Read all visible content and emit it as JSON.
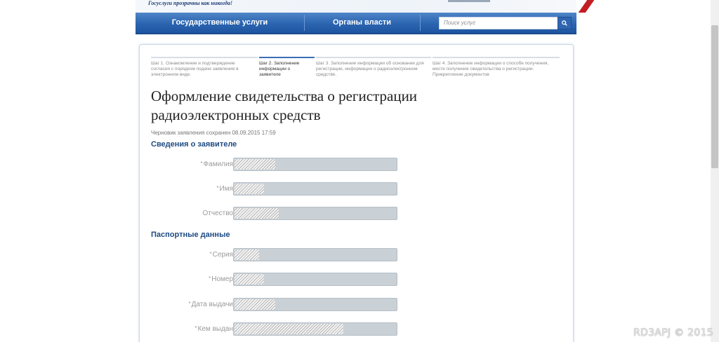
{
  "banner": {
    "slogan": "Госуслуги прозрачны как никогда!"
  },
  "nav": {
    "items": [
      {
        "label": "Государственные услуги"
      },
      {
        "label": "Органы власти"
      }
    ],
    "search": {
      "placeholder": "Поиск услуг"
    },
    "search_icon": "search-icon"
  },
  "steps": [
    {
      "label": "Шаг 1. Ознакомление и подтверждение согласия с порядком подачи заявления в электронном виде."
    },
    {
      "label": "Шаг 2. Заполнение информации о заявителе",
      "active": true
    },
    {
      "label": "Шаг 3. Заполнение информации об основании для регистрации, информации о радиоэлектронном средстве."
    },
    {
      "label": "Шаг 4. Заполнение информации о способе получения, месте получения свидетельства о регистрации. Прикрепление документов"
    }
  ],
  "page": {
    "title": "Оформление свидетельства о регистрации радиоэлектронных средств",
    "draft_note": "Черновик заявления сохранен 08.09.2015 17:59"
  },
  "sections": {
    "applicant": {
      "title": "Сведения о заявителе",
      "fields": [
        {
          "label": "Фамилия",
          "required": true,
          "fill": 0.25
        },
        {
          "label": "Имя",
          "required": true,
          "fill": 0.18
        },
        {
          "label": "Отчество",
          "required": false,
          "fill": 0.27
        }
      ]
    },
    "passport": {
      "title": "Паспортные данные",
      "fields": [
        {
          "label": "Серия",
          "required": true,
          "fill": 0.15
        },
        {
          "label": "Номер",
          "required": true,
          "fill": 0.18
        },
        {
          "label": "Дата выдачи",
          "required": true,
          "fill": 0.25
        },
        {
          "label": "Кем выдан",
          "required": true,
          "fill": 0.67
        }
      ]
    }
  },
  "required_mark": "*",
  "watermark": "RD3APJ © 2015"
}
